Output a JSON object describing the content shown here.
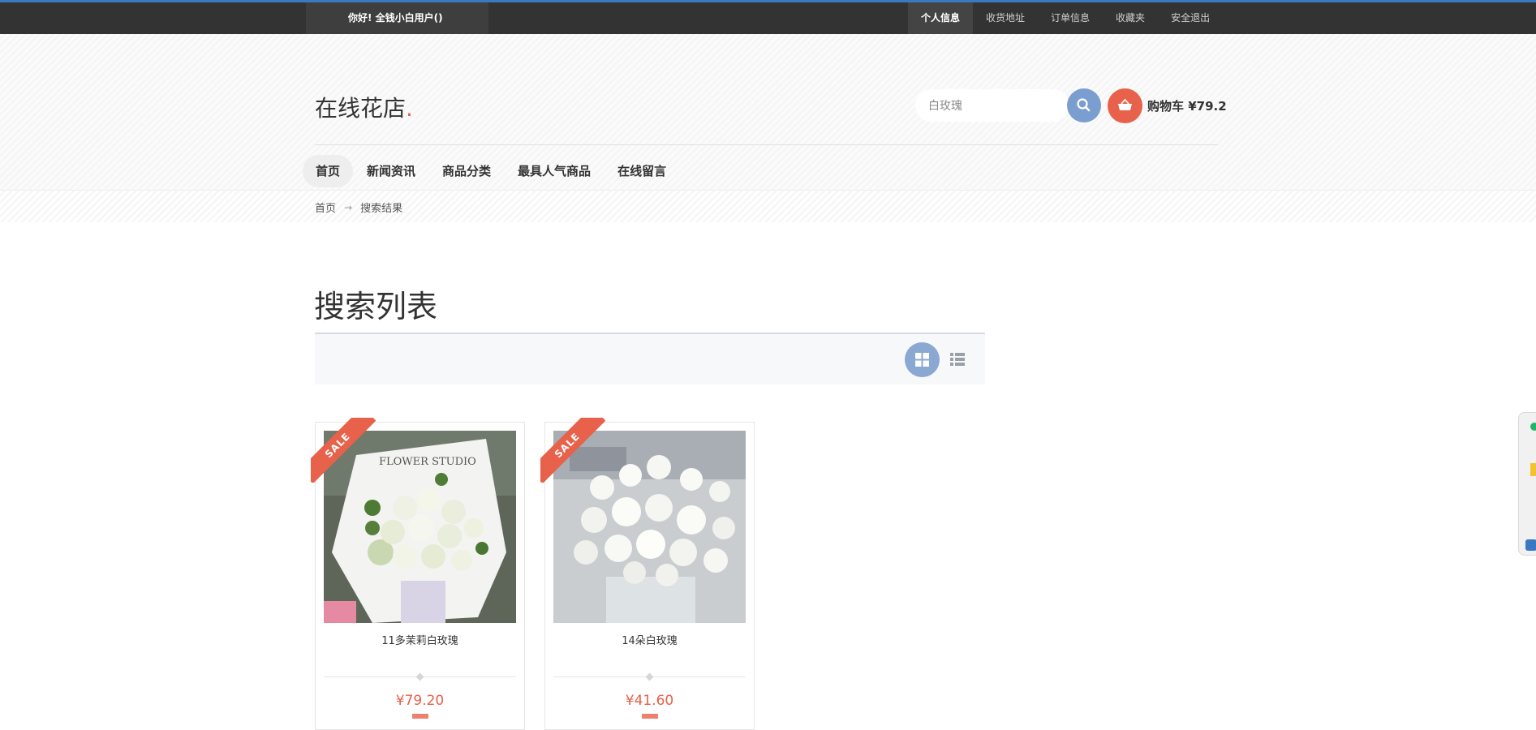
{
  "topbar": {
    "greeting": "你好!  全钱小白用户()",
    "links": [
      "个人信息",
      "收货地址",
      "订单信息",
      "收藏夹",
      "安全退出"
    ]
  },
  "header": {
    "logo": "在线花店",
    "logo_dot": ".",
    "search_value": "白玫瑰",
    "cart_label": "购物车 ¥79.2"
  },
  "nav": {
    "items": [
      "首页",
      "新闻资讯",
      "商品分类",
      "最具人气商品",
      "在线留言"
    ]
  },
  "breadcrumb": {
    "home": "首页",
    "arrow": "→",
    "current": "搜索结果"
  },
  "page": {
    "title": "搜索列表"
  },
  "products": [
    {
      "name": "11多茉莉白玫瑰",
      "price": "¥79.20",
      "ribbon": "SALE"
    },
    {
      "name": "14朵白玫瑰",
      "price": "¥41.60",
      "ribbon": "SALE"
    }
  ],
  "colors": {
    "accent": "#e8614a",
    "topbar": "#333333",
    "search_button": "#7b9ed1",
    "grid_button": "#8aa8d2"
  }
}
